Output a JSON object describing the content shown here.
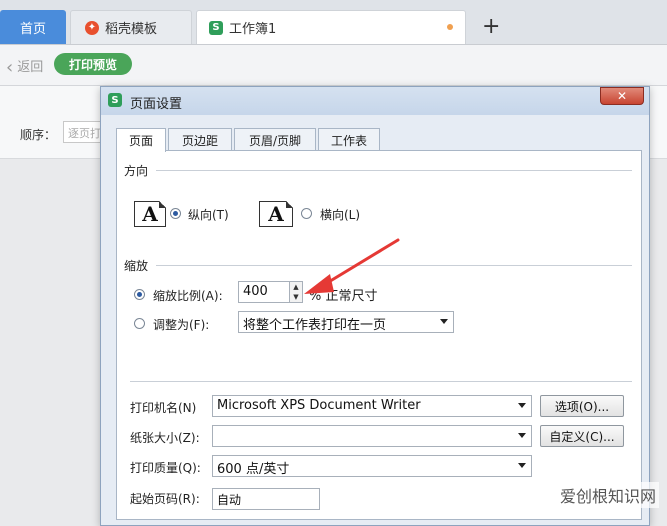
{
  "tabs": {
    "home": "首页",
    "template": "稻壳模板",
    "workbook": "工作簿1",
    "add": "+"
  },
  "toolbar": {
    "back_icon": "‹",
    "back": "返回",
    "print_preview": "打印预览"
  },
  "ribbon": {
    "order_label": "顺序：",
    "order_value": "逐页打"
  },
  "dialog": {
    "title": "页面设置",
    "close": "✕",
    "tabs": [
      "页面",
      "页边距",
      "页眉/页脚",
      "工作表"
    ],
    "orientation": {
      "label": "方向",
      "portrait": "纵向(T)",
      "landscape": "横向(L)",
      "selected": "portrait"
    },
    "scale": {
      "label": "缩放",
      "ratio_label": "缩放比例(A):",
      "ratio_value": "400",
      "ratio_suffix": "% 正常尺寸",
      "fit_label": "调整为(F):",
      "fit_value": "将整个工作表打印在一页",
      "selected": "ratio"
    },
    "printer": {
      "label": "打印机名(N)",
      "value": "Microsoft XPS Document Writer",
      "options_button": "选项(O)..."
    },
    "paper": {
      "label": "纸张大小(Z):",
      "value": "",
      "custom_button": "自定义(C)..."
    },
    "quality": {
      "label": "打印质量(Q):",
      "value": "600 点/英寸"
    },
    "start_page": {
      "label": "起始页码(R):",
      "value": "自动"
    }
  },
  "watermark": "爱创根知识网",
  "colors": {
    "home_tab": "#4a8cdb",
    "preview_button": "#4aa559",
    "annotation_arrow": "#e53935",
    "close_button": "#c84532"
  }
}
